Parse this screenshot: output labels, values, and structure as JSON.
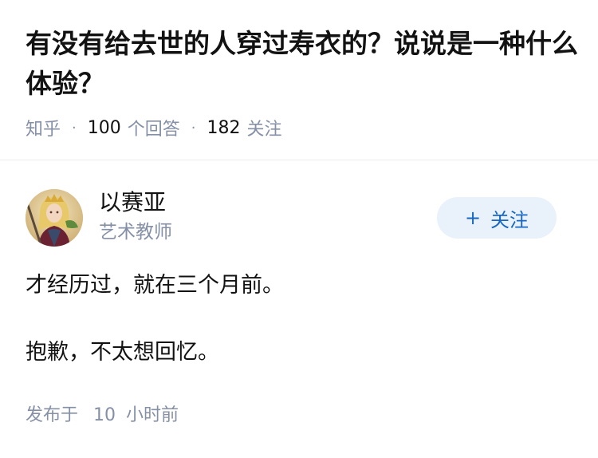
{
  "question": {
    "title": "有没有给去世的人穿过寿衣的？说说是一种什么体验？",
    "source": "知乎",
    "answers_count": "100",
    "answers_label": "个回答",
    "followers_count": "182",
    "followers_label": "关注"
  },
  "answer": {
    "author": {
      "name": "以赛亚",
      "role": "艺术教师",
      "avatar_icon": "illustrated-character-avatar"
    },
    "follow_button": {
      "plus": "+",
      "label": "关注"
    },
    "paragraphs": [
      "才经历过，就在三个月前。",
      "抱歉，不太想回忆。"
    ],
    "published_label": "发布于",
    "published_num": "10",
    "published_unit": "小时前"
  },
  "colors": {
    "text": "#121212",
    "muted": "#8590a6",
    "accent": "#1766c1",
    "button_bg": "#e9f2fb",
    "divider": "#ebebeb"
  }
}
